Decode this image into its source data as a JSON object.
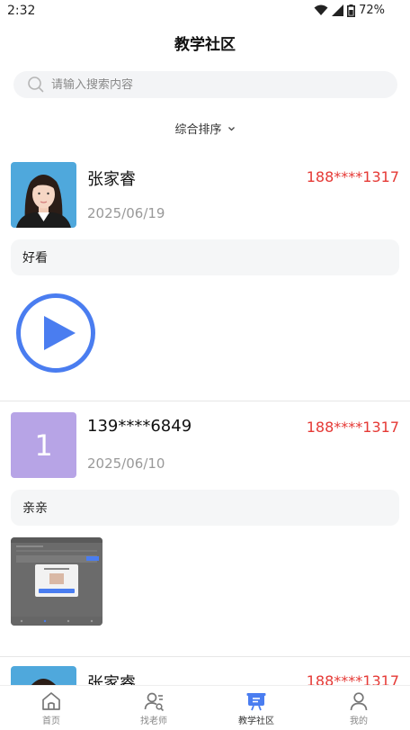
{
  "status": {
    "time": "2:32",
    "battery": "72%"
  },
  "header": {
    "title": "教学社区"
  },
  "search": {
    "placeholder": "请输入搜索内容"
  },
  "sort": {
    "label": "综合排序"
  },
  "posts": [
    {
      "name": "张家睿",
      "phone": "188****1317",
      "date": "2025/06/19",
      "text": "好看",
      "media": "video"
    },
    {
      "name": "139****6849",
      "avatar_letter": "1",
      "phone": "188****1317",
      "date": "2025/06/10",
      "text": "亲亲",
      "media": "image"
    },
    {
      "name": "张家睿",
      "phone": "188****1317"
    }
  ],
  "tabs": [
    {
      "label": "首页",
      "icon": "home-icon"
    },
    {
      "label": "找老师",
      "icon": "find-teacher-icon"
    },
    {
      "label": "教学社区",
      "icon": "community-icon",
      "active": true
    },
    {
      "label": "我的",
      "icon": "profile-icon"
    }
  ],
  "colors": {
    "accent": "#4a7df0",
    "phone": "#e53935",
    "letter_avatar": "#b7a4e6"
  }
}
